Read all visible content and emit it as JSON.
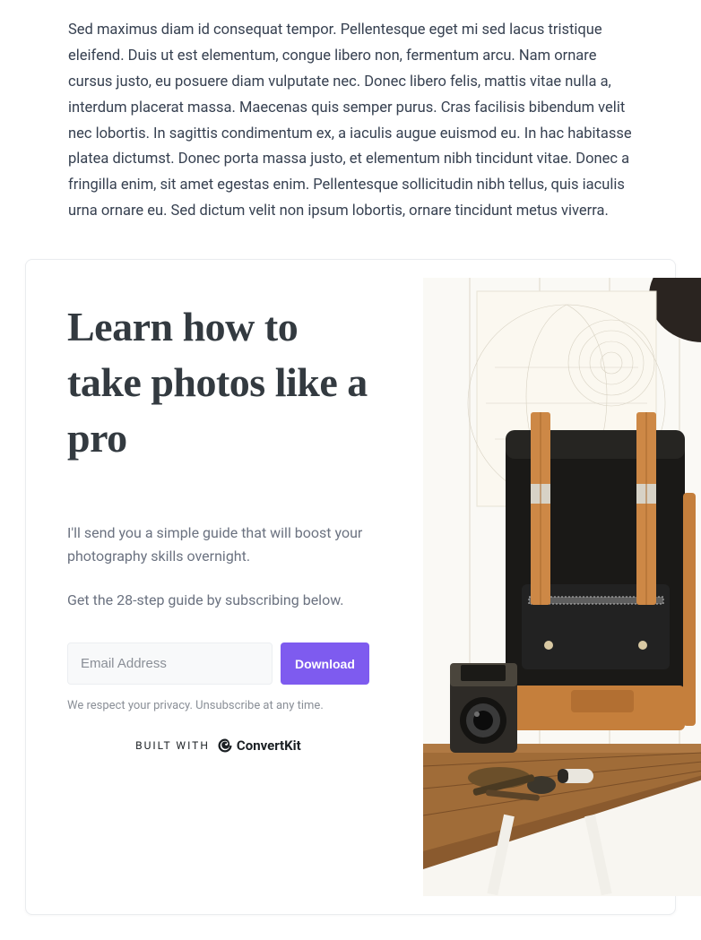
{
  "intro": "Sed maximus diam id consequat tempor. Pellentesque eget mi sed lacus tristique eleifend. Duis ut est elementum, congue libero non, fermentum arcu. Nam ornare cursus justo, eu posuere diam vulputate nec. Donec libero felis, mattis vitae nulla a, interdum placerat massa. Maecenas quis semper purus. Cras facilisis bibendum velit nec lobortis. In sagittis condimentum ex, a iaculis augue euismod eu. In hac habitasse platea dictumst. Donec porta massa justo, et elementum nibh tincidunt vitae. Donec a fringilla enim, sit amet egestas enim. Pellentesque sollicitudin nibh tellus, quis iaculis urna ornare eu. Sed dictum velit non ipsum lobortis, ornare tincidunt metus viverra.",
  "card": {
    "title": "Learn how to take photos like a pro",
    "desc1": "I'll send you a simple guide that will boost your photography skills overnight.",
    "desc2": "Get the 28-step guide by subscribing below.",
    "email_placeholder": "Email Address",
    "button_label": "Download",
    "privacy": "We respect your privacy. Unsubscribe at any time.",
    "built_with_label": "BUILT WITH",
    "brand": "ConvertKit"
  }
}
